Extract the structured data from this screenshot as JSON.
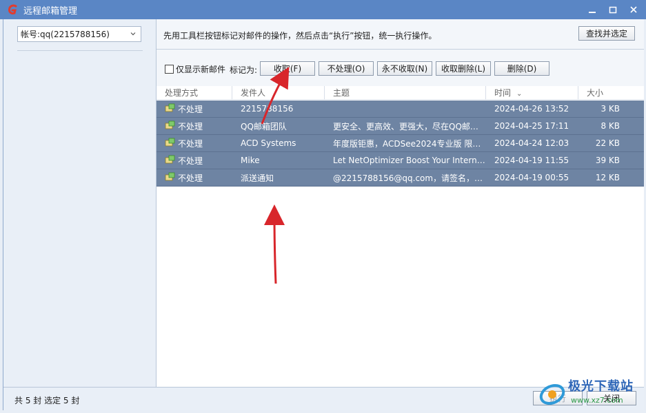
{
  "window": {
    "title": "远程邮箱管理"
  },
  "account": {
    "selected": "帐号:qq(2215788156)"
  },
  "info_bar": {
    "text": "先用工具栏按钮标记对邮件的操作，然后点击“执行”按钮，统一执行操作。",
    "find_button": "查找并选定"
  },
  "toolbar": {
    "new_only_label": "仅显示新邮件",
    "mark_label": "标记为:",
    "receive": "收取(F)",
    "skip": "不处理(O)",
    "never_receive": "永不收取(N)",
    "receive_delete": "收取删除(L)",
    "delete": "删除(D)"
  },
  "table": {
    "columns": [
      "处理方式",
      "发件人",
      "主题",
      "时间",
      "大小"
    ],
    "rows": [
      {
        "action": "不处理",
        "sender": "2215788156",
        "subject": "",
        "time": "2024-04-26 13:52",
        "size": "3 KB"
      },
      {
        "action": "不处理",
        "sender": "QQ邮箱团队",
        "subject": "更安全、更高效、更强大，尽在QQ邮箱...",
        "time": "2024-04-25 17:11",
        "size": "8 KB"
      },
      {
        "action": "不处理",
        "sender": "ACD Systems",
        "subject": "年度版钜惠，ACDSee2024专业版 限时...",
        "time": "2024-04-24 12:03",
        "size": "22 KB"
      },
      {
        "action": "不处理",
        "sender": "Mike",
        "subject": "Let NetOptimizer Boost Your Interne...",
        "time": "2024-04-19 11:55",
        "size": "39 KB"
      },
      {
        "action": "不处理",
        "sender": "派送通知",
        "subject": "@2215788156@qq.com，请签名，你...",
        "time": "2024-04-19 00:55",
        "size": "12 KB"
      }
    ]
  },
  "status": {
    "text": "共 5 封 选定 5 封",
    "execute_button": "执行",
    "close_button": "关闭"
  },
  "watermark": {
    "cn": "极光下载站",
    "url": "www.xz7.com"
  },
  "colors": {
    "titlebar": "#5a86c5",
    "selected_row": "#6e84a3",
    "arrow": "#d8262b"
  }
}
